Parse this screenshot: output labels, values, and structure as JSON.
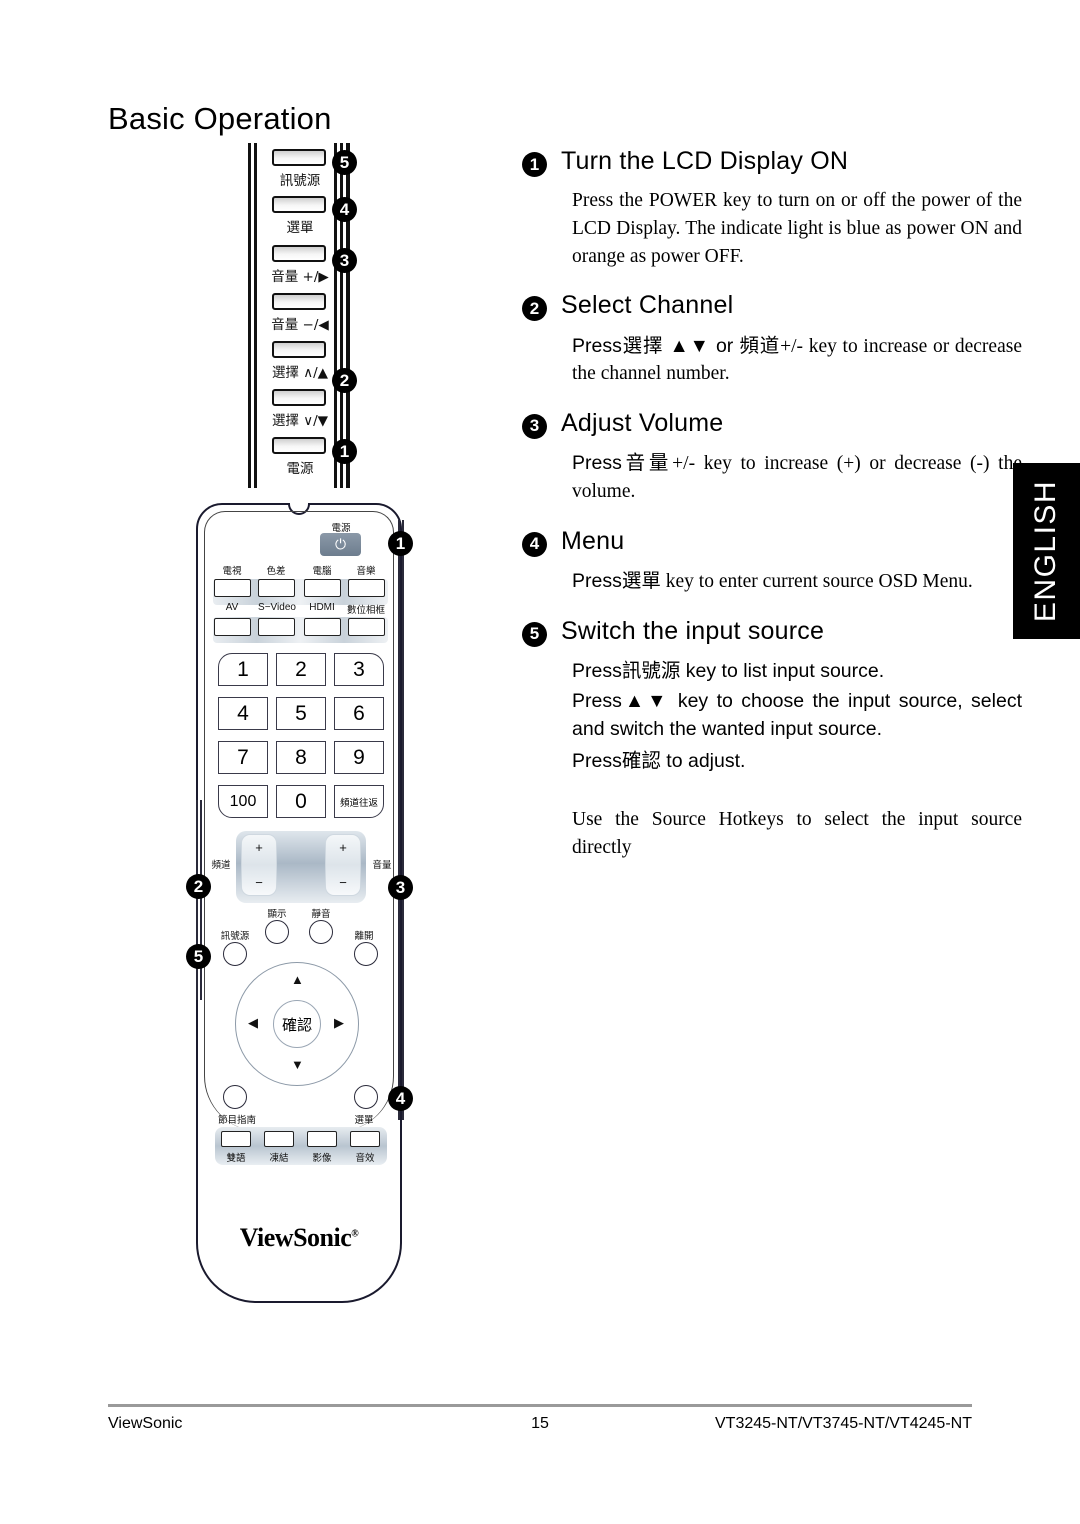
{
  "page": {
    "title": "Basic Operation",
    "side_tab": "ENGLISH"
  },
  "steps": [
    {
      "num": "1",
      "title": "Turn the LCD Display ON",
      "body": "Press the POWER key to turn on or off the power of the LCD Display. The indicate light is blue as power ON and orange as power OFF."
    },
    {
      "num": "2",
      "title": "Select Channel",
      "body_pre": "Press",
      "body_cjk1": "選擇",
      "body_mid1": " ▲▼ or ",
      "body_cjk2": "頻道",
      "body_post": "+/- key to increase or decrease the channel number."
    },
    {
      "num": "3",
      "title": "Adjust Volume",
      "body_pre": "Press",
      "body_cjk1": "音量",
      "body_post": "+/- key to increase (+) or decrease (-) the volume."
    },
    {
      "num": "4",
      "title": "Menu",
      "body_pre": "Press",
      "body_cjk1": "選單",
      "body_post": " key to enter current source OSD Menu."
    },
    {
      "num": "5",
      "title": "Switch the input source",
      "line1_pre": "Press",
      "line1_cjk": "訊號源",
      "line1_post": " key to list input source.",
      "line2_pre": "Press",
      "line2_sym": "▲▼",
      "line2_post": " key to choose the input source, select and switch the wanted input source.",
      "line3_pre": "Press",
      "line3_cjk": "確認",
      "line3_post": " to adjust.",
      "extra": "Use the Source Hotkeys to select the input source directly"
    }
  ],
  "side_panel": {
    "buttons": [
      {
        "label": "訊號源",
        "callout": "5"
      },
      {
        "label": "選單",
        "callout": "4"
      },
      {
        "label": "音量 +/▶",
        "callout": "3"
      },
      {
        "label": "音量 −/◀",
        "callout": ""
      },
      {
        "label": "選擇 ∧/▲",
        "callout": "2"
      },
      {
        "label": "選擇 ∨/▼",
        "callout": ""
      },
      {
        "label": "電源",
        "callout": "1"
      }
    ]
  },
  "remote": {
    "power_label": "電源",
    "power_icon": "⏻",
    "source_row1": [
      "電視",
      "色差",
      "電腦",
      "音樂"
    ],
    "source_row2": [
      "AV",
      "S−Video",
      "HDMI",
      "數位相框"
    ],
    "numpad": [
      "1",
      "2",
      "3",
      "4",
      "5",
      "6",
      "7",
      "8",
      "9",
      "100",
      "0",
      "頻道往返"
    ],
    "rocker_left_label": "頻道",
    "rocker_right_label": "音量",
    "rocker_plus": "+",
    "rocker_minus": "−",
    "round_buttons": {
      "display": "顯示",
      "mute": "靜音",
      "source": "訊號源",
      "exit": "離開",
      "guide": "節目指南",
      "menu": "選單"
    },
    "dpad": {
      "ok": "確認",
      "up": "▲",
      "down": "▼",
      "left": "◀",
      "right": "▶"
    },
    "fn_buttons": [
      "雙語",
      "凍結",
      "影像",
      "音效"
    ],
    "brand": "ViewSonic",
    "brand_mark": "®",
    "callouts": [
      "1",
      "2",
      "3",
      "4",
      "5"
    ]
  },
  "footer": {
    "left": "ViewSonic",
    "page_number": "15",
    "right": "VT3245-NT/VT3745-NT/VT4245-NT"
  }
}
